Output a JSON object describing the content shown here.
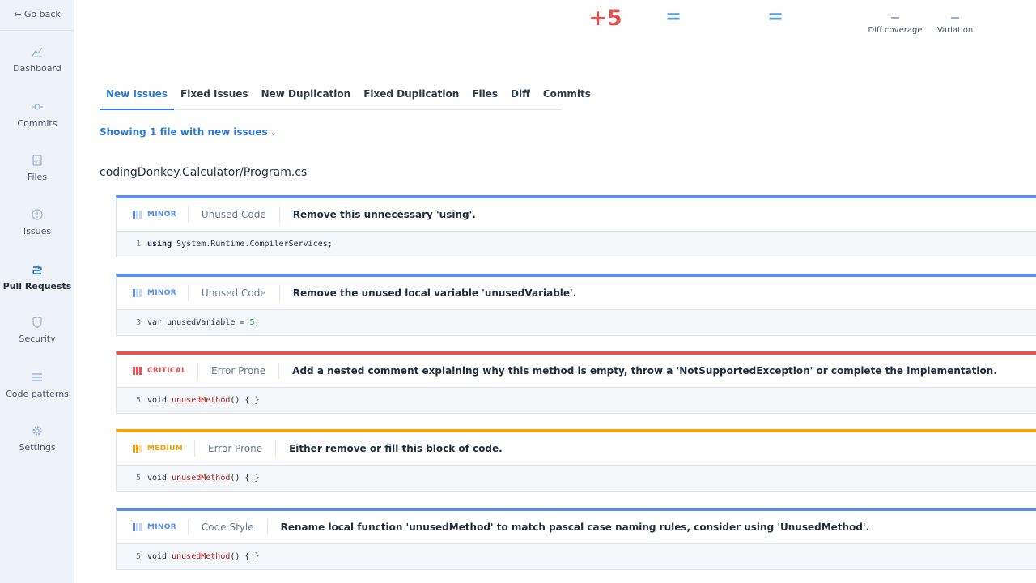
{
  "sidebar": {
    "go_back": "← Go back",
    "items": [
      {
        "label": "Dashboard",
        "icon": "chart-line-icon"
      },
      {
        "label": "Commits",
        "icon": "commit-icon"
      },
      {
        "label": "Files",
        "icon": "file-icon"
      },
      {
        "label": "Issues",
        "icon": "alert-circle-icon"
      },
      {
        "label": "Pull Requests",
        "icon": "pull-request-icon",
        "active": true
      },
      {
        "label": "Security",
        "icon": "shield-icon"
      },
      {
        "label": "Code patterns",
        "icon": "list-icon"
      },
      {
        "label": "Settings",
        "icon": "gear-icon"
      }
    ]
  },
  "metrics": {
    "new_issues": "+5",
    "duplication": "=",
    "complexity": "=",
    "diff_coverage_value": "-",
    "diff_coverage_label": "Diff coverage",
    "variation_value": "-",
    "variation_label": "Variation",
    "new_issues_color": "#e45353"
  },
  "tabs": [
    {
      "label": "New Issues",
      "active": true
    },
    {
      "label": "Fixed Issues"
    },
    {
      "label": "New Duplication"
    },
    {
      "label": "Fixed Duplication"
    },
    {
      "label": "Files"
    },
    {
      "label": "Diff"
    },
    {
      "label": "Commits"
    }
  ],
  "showing": "Showing 1 file with new issues",
  "file_path": "codingDonkey.Calculator/Program.cs",
  "issues": [
    {
      "severity": "MINOR",
      "category": "Unused Code",
      "message": "Remove this unnecessary 'using'.",
      "line": "1",
      "code": {
        "kw": "using",
        "rest": " System.Runtime.CompilerServices;"
      }
    },
    {
      "severity": "MINOR",
      "category": "Unused Code",
      "message": "Remove the unused local variable 'unusedVariable'.",
      "line": "3",
      "code": {
        "pre": "var unusedVariable = ",
        "num": "5",
        "post": ";"
      }
    },
    {
      "severity": "CRITICAL",
      "category": "Error Prone",
      "message": "Add a nested comment explaining why this method is empty, throw a 'NotSupportedException' or complete the implementation.",
      "line": "5",
      "code": {
        "pre": "void ",
        "fn": "unusedMethod",
        "post": "() { }"
      }
    },
    {
      "severity": "MEDIUM",
      "category": "Error Prone",
      "message": "Either remove or fill this block of code.",
      "line": "5",
      "code": {
        "pre": "void ",
        "fn": "unusedMethod",
        "post": "() { }"
      }
    },
    {
      "severity": "MINOR",
      "category": "Code Style",
      "message": "Rename local function 'unusedMethod' to match pascal case naming rules, consider using 'UnusedMethod'.",
      "line": "5",
      "code": {
        "pre": "void ",
        "fn": "unusedMethod",
        "post": "() { }"
      }
    }
  ]
}
